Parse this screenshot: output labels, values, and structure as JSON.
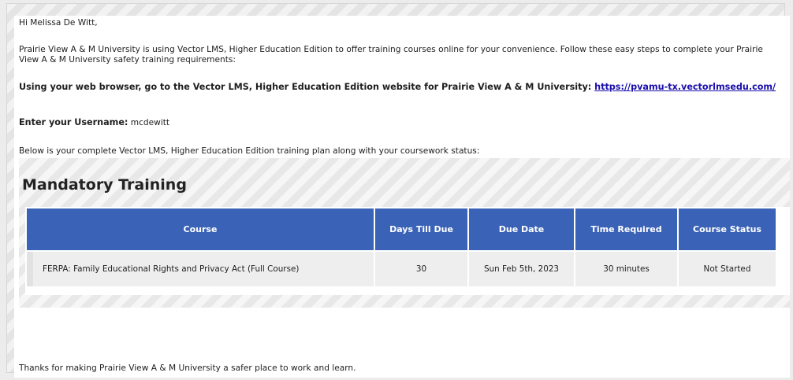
{
  "email": {
    "greeting": "Hi Melissa De Witt,",
    "intro": "Prairie View A & M University is using Vector LMS, Higher Education Edition to offer training courses online for your convenience. Follow these easy steps to complete your Prairie View A & M University safety training requirements:",
    "step1_text": "Using your web browser, go to the Vector LMS, Higher Education Edition website for Prairie View A & M University:",
    "step1_link": "https://pvamu-tx.vectorlmsedu.com/",
    "username_label": "Enter your Username:",
    "username_value": "mcdewitt",
    "plan_intro": "Below is your complete Vector LMS, Higher Education Edition training plan along with your coursework status:",
    "closing": "Thanks for making Prairie View A & M University a safer place to work and learn."
  },
  "training": {
    "title": "Mandatory Training",
    "columns": [
      "Course",
      "Days Till Due",
      "Due Date",
      "Time Required",
      "Course Status"
    ],
    "rows": [
      {
        "course": "FERPA: Family Educational Rights and Privacy Act (Full Course)",
        "days_till_due": "30",
        "due_date": "Sun Feb 5th, 2023",
        "time_required": "30 minutes",
        "status": "Not Started"
      }
    ]
  },
  "colors": {
    "header_bg": "#3a62b7",
    "row_bg": "#eeeeee",
    "link": "#1a0dab"
  }
}
